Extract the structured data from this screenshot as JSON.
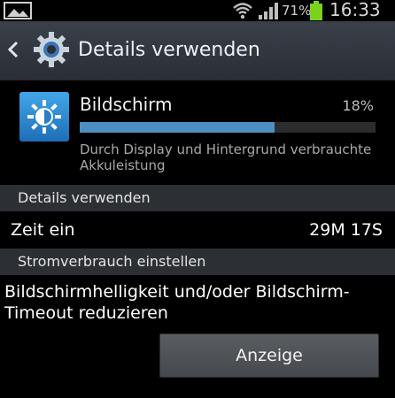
{
  "status_bar": {
    "battery_percent": "71%",
    "time": "16:33",
    "icons": [
      "gallery-icon",
      "wifi-icon",
      "signal-icon",
      "battery-icon"
    ]
  },
  "action_bar": {
    "title": "Details verwenden",
    "icons": [
      "back-icon",
      "settings-gear-icon"
    ]
  },
  "app_detail": {
    "name": "Bildschirm",
    "percent": "18%",
    "usage_fraction": 0.66,
    "description": "Durch Display und Hintergrund verbrauchte Akkuleistung",
    "icon": "brightness-icon"
  },
  "sections": {
    "details_header": "Details verwenden",
    "power_header": "Stromverbrauch einstellen"
  },
  "time_row": {
    "label": "Zeit ein",
    "value": "29M 17S"
  },
  "suggestion": {
    "text": "Bildschirmhelligkeit und/oder Bildschirm-Timeout reduzieren",
    "button_label": "Anzeige"
  },
  "colors": {
    "accent_blue": "#4e8fc2",
    "battery_green": "#7cd11f",
    "header_bg": "#2c2f33"
  }
}
